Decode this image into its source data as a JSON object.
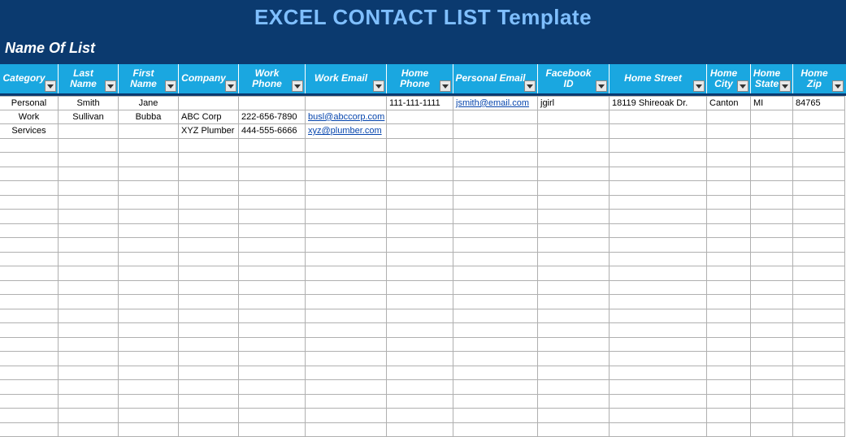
{
  "banner": {
    "title": "EXCEL CONTACT LIST Template",
    "subtitle": "Name Of List"
  },
  "columns": [
    {
      "label": "Category"
    },
    {
      "label": "Last Name"
    },
    {
      "label": "First Name"
    },
    {
      "label": "Company"
    },
    {
      "label": "Work Phone"
    },
    {
      "label": "Work Email"
    },
    {
      "label": "Home Phone"
    },
    {
      "label": "Personal Email"
    },
    {
      "label": "Facebook ID"
    },
    {
      "label": "Home Street"
    },
    {
      "label": "Home City"
    },
    {
      "label": "Home State"
    },
    {
      "label": "Home Zip"
    }
  ],
  "rows": [
    {
      "category": "Personal",
      "last_name": "Smith",
      "first_name": "Jane",
      "company": "",
      "work_phone": "",
      "work_email": "",
      "home_phone": "111-111-1111",
      "personal_email": "jsmith@email.com",
      "facebook_id": "jgirl",
      "home_street": "18119 Shireoak Dr.",
      "home_city": "Canton",
      "home_state": "MI",
      "home_zip": "84765"
    },
    {
      "category": "Work",
      "last_name": "Sullivan",
      "first_name": "Bubba",
      "company": "ABC Corp",
      "work_phone": "222-656-7890",
      "work_email": "busl@abccorp.com",
      "home_phone": "",
      "personal_email": "",
      "facebook_id": "",
      "home_street": "",
      "home_city": "",
      "home_state": "",
      "home_zip": ""
    },
    {
      "category": "Services",
      "last_name": "",
      "first_name": "",
      "company": "XYZ Plumber",
      "work_phone": "444-555-6666",
      "work_email": "xyz@plumber.com",
      "home_phone": "",
      "personal_email": "",
      "facebook_id": "",
      "home_street": "",
      "home_city": "",
      "home_state": "",
      "home_zip": ""
    }
  ],
  "empty_row_count": 21,
  "link_columns": [
    "work_email",
    "personal_email"
  ],
  "centered_columns": [
    "category",
    "last_name",
    "first_name"
  ]
}
